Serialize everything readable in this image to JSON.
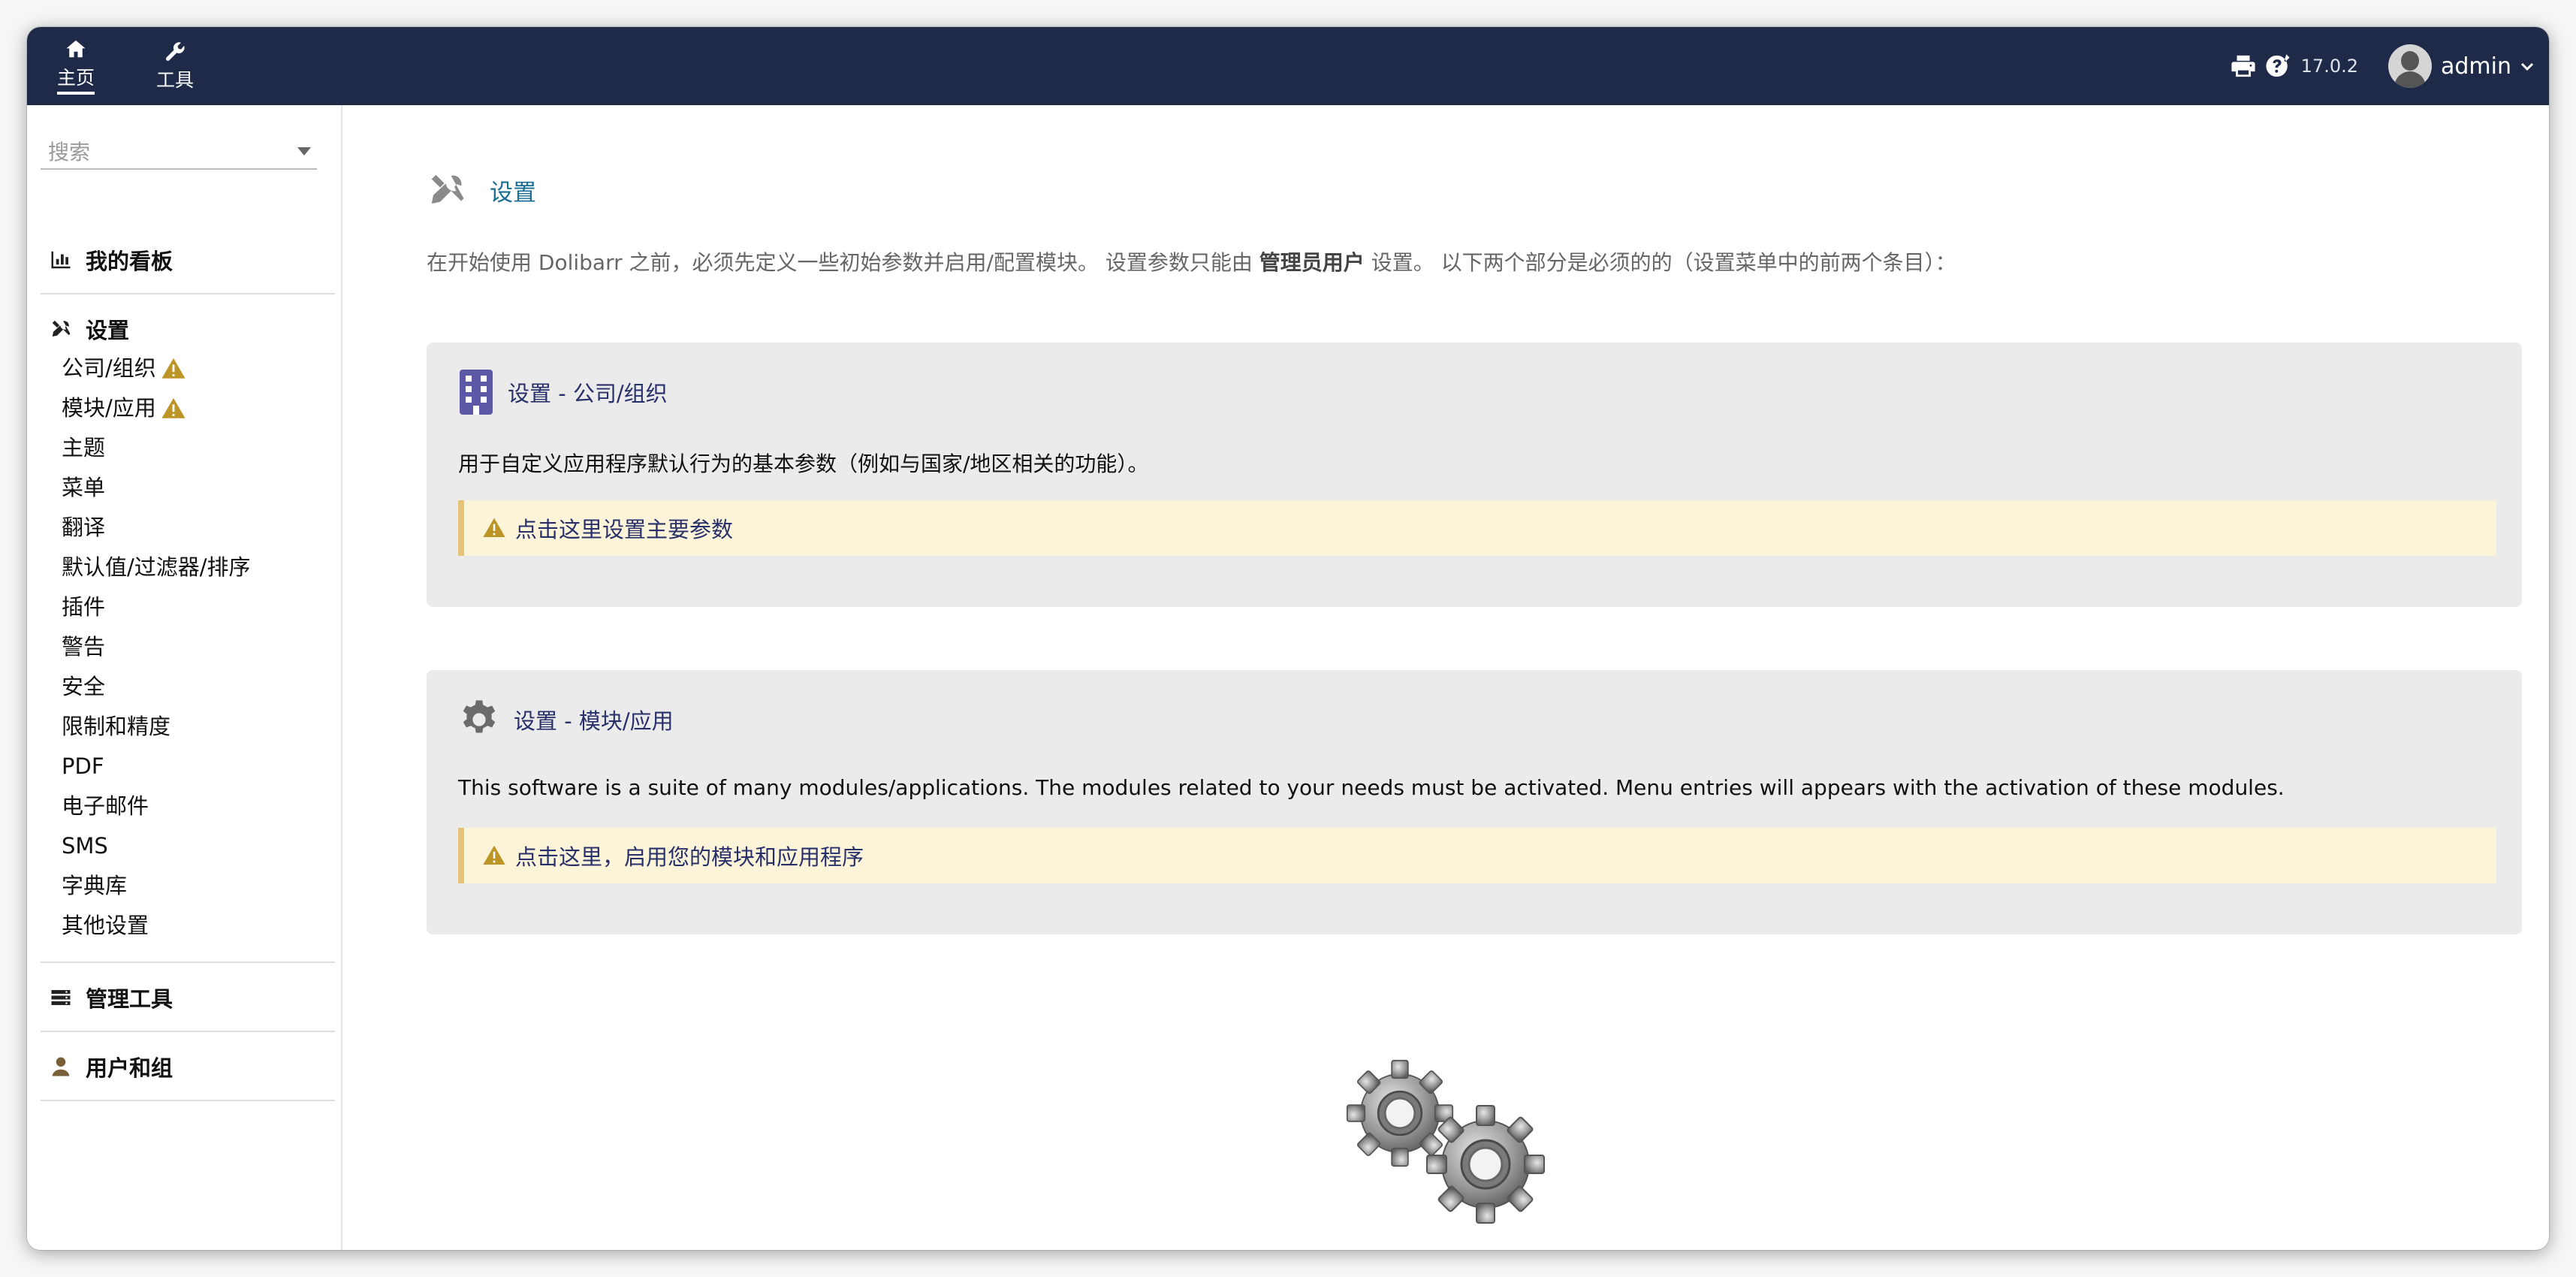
{
  "topbar": {
    "nav": [
      {
        "label": "主页",
        "icon": "home-icon"
      },
      {
        "label": "工具",
        "icon": "wrench-icon"
      }
    ],
    "version": "17.0.2",
    "user": "admin"
  },
  "sidebar": {
    "search_placeholder": "搜索",
    "dashboard": "我的看板",
    "setup": {
      "label": "设置",
      "items": [
        "公司/组织",
        "模块/应用",
        "主题",
        "菜单",
        "翻译",
        "默认值/过滤器/排序",
        "插件",
        "警告",
        "安全",
        "限制和精度",
        "PDF",
        "电子邮件",
        "SMS",
        "字典库",
        "其他设置"
      ]
    },
    "admin_tools": "管理工具",
    "users_groups": "用户和组"
  },
  "main": {
    "title": "设置",
    "intro_prefix": "在开始使用 Dolibarr 之前，必须先定义一些初始参数并启用/配置模块。 设置参数只能由",
    "intro_bold": "管理员用户",
    "intro_suffix": "设置。 以下两个部分是必须的的（设置菜单中的前两个条目）：",
    "company_panel": {
      "title": "设置 - 公司/组织",
      "description": "用于自定义应用程序默认行为的基本参数（例如与国家/地区相关的功能）。",
      "notice": "点击这里设置主要参数"
    },
    "modules_panel": {
      "title": "设置 - 模块/应用",
      "description": "This software is a suite of many modules/applications. The modules related to your needs must be activated. Menu entries will appears with the activation of these modules.",
      "notice": "点击这里，启用您的模块和应用程序"
    }
  },
  "colors": {
    "topbar": "#1e2a48",
    "link": "#28306b",
    "title": "#1a6e92",
    "warning": "#bc9526",
    "notice_bg": "#fbf4d8"
  }
}
